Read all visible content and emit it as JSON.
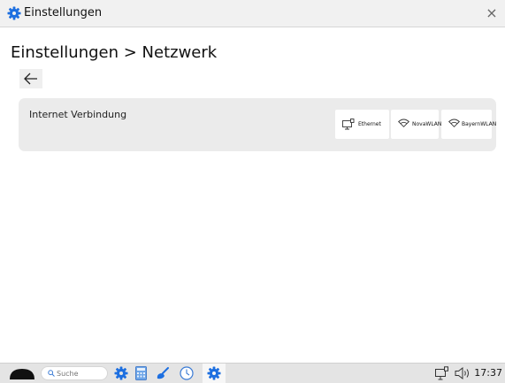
{
  "window": {
    "title": "Einstellungen",
    "close_symbol": "×"
  },
  "page": {
    "heading": "Einstellungen > Netzwerk",
    "back_icon": "arrow-left-icon"
  },
  "internet": {
    "label": "Internet Verbindung",
    "options": [
      {
        "name": "Ethernet",
        "icon": "ethernet-icon"
      },
      {
        "name": "NovaWLAN",
        "icon": "wifi-icon"
      },
      {
        "name": "BayernWLAN",
        "icon": "wifi-icon"
      }
    ]
  },
  "taskbar": {
    "search_placeholder": "Suche",
    "apps": [
      "settings-icon",
      "calculator-icon",
      "paint-icon",
      "clock-icon",
      "settings-icon"
    ],
    "tray": [
      "network-icon",
      "volume-icon"
    ],
    "time": "17:37"
  },
  "colors": {
    "accent_blue": "#1e6fd9",
    "settings_gear": "#1d6fe0",
    "card_bg": "#ebebeb"
  }
}
